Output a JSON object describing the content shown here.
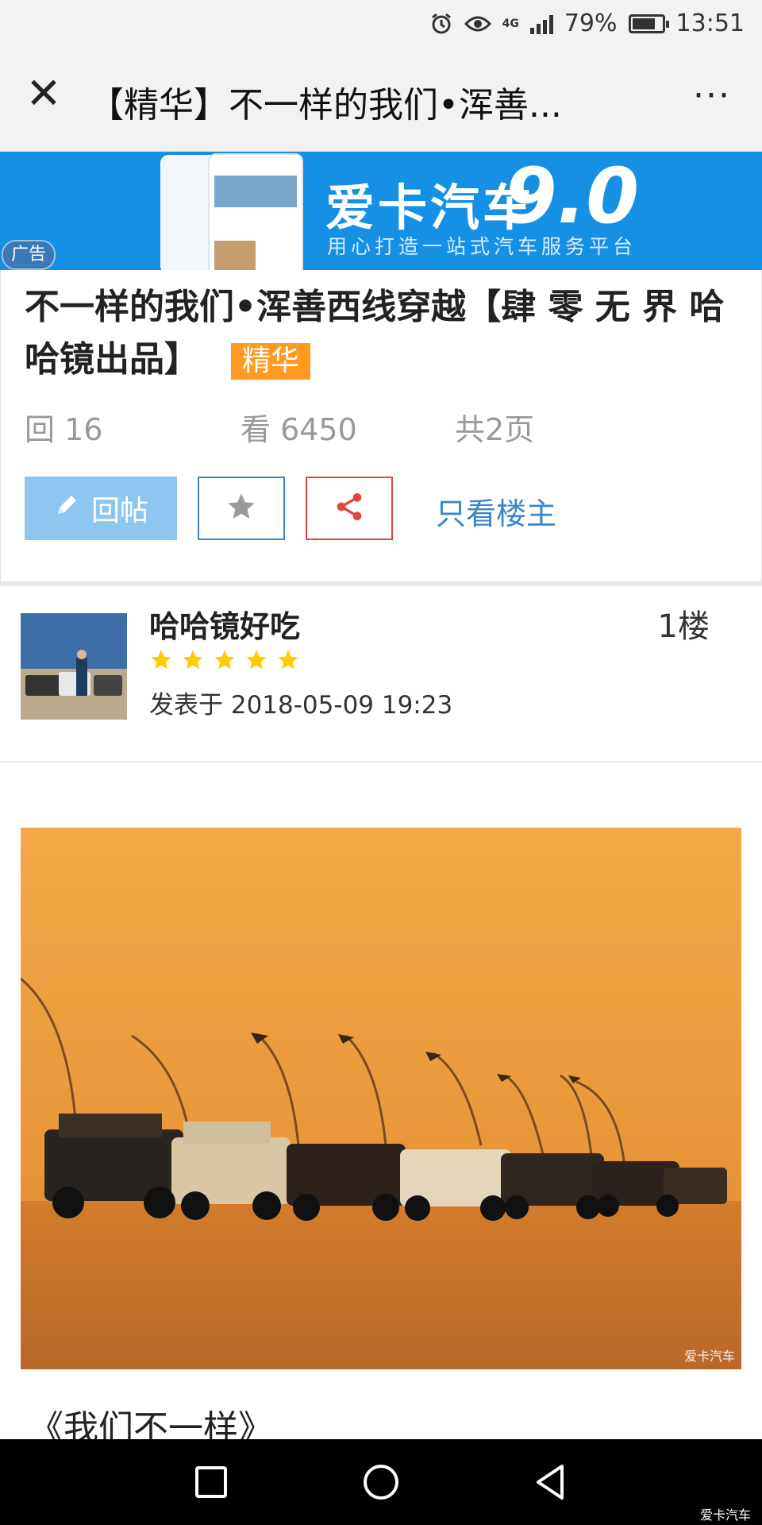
{
  "status_bar": {
    "network": "4G",
    "battery_text": "79%",
    "battery_level": 0.79,
    "time": "13:51",
    "icons": [
      "alarm-icon",
      "eye-icon",
      "signal-icon",
      "battery-icon"
    ]
  },
  "nav": {
    "close_icon": "✕",
    "title": "【精华】不一样的我们•浑善...",
    "more_icon": "···"
  },
  "ad": {
    "brand": "爱卡汽车",
    "version": "9.0",
    "slogan": "用心打造一站式汽车服务平台",
    "tag": "广告",
    "brand_color": "#1690e4"
  },
  "post": {
    "title": "不一样的我们•浑善西线穿越【肆 零 无 界 哈哈镜出品】",
    "badge": "精华",
    "replies": "回 16",
    "views": "看 6450",
    "pages": "共2页",
    "reply_label": "回帖",
    "only_op_label": "只看楼主",
    "accent_color": "#3a86c7",
    "share_color": "#e0483e",
    "badge_color": "#ff9a1f"
  },
  "floor": {
    "author": "哈哈镜好吃",
    "floor_label": "1楼",
    "rating": 5,
    "rating_max": 5,
    "posted_at": "发表于 2018-05-09 19:23"
  },
  "photo": {
    "watermark": "爱卡汽车"
  },
  "content": {
    "quote_title": "《我们不一样》"
  },
  "bottom_watermark": "爱卡汽车"
}
